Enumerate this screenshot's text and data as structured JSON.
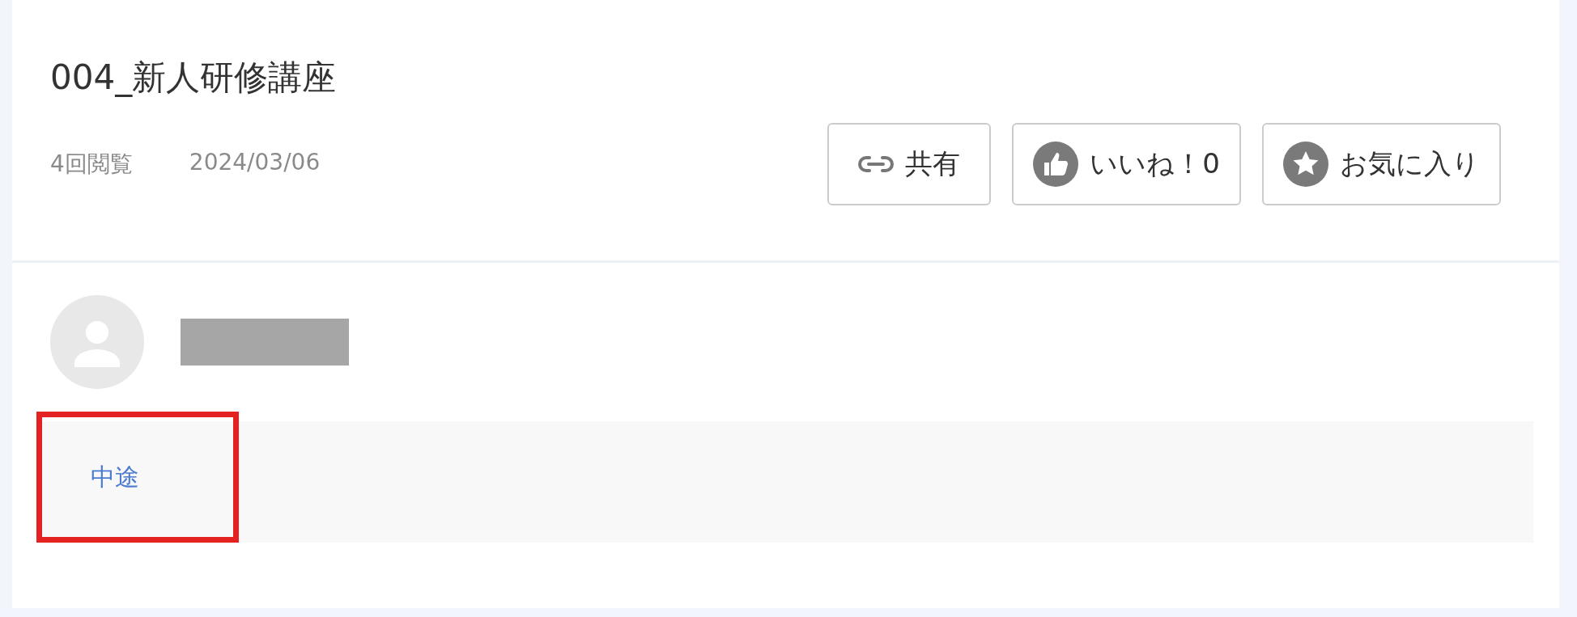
{
  "title": "004_新人研修講座",
  "meta": {
    "views": "4回閲覧",
    "date": "2024/03/06"
  },
  "actions": [
    {
      "kind": "share",
      "label": "共有"
    },
    {
      "kind": "like",
      "label": "いいね！0"
    },
    {
      "kind": "favorite",
      "label": "お気に入り"
    }
  ],
  "author": {
    "name_redacted": true
  },
  "tags": [
    {
      "label": "中途",
      "highlighted": true
    }
  ]
}
